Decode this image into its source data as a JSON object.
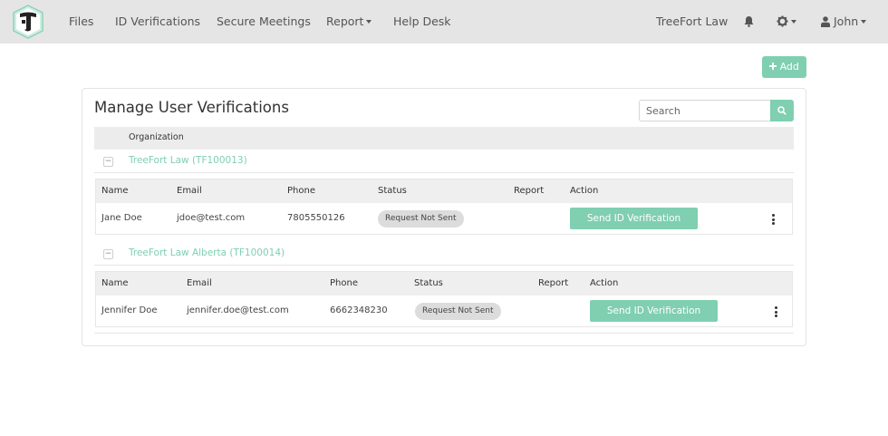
{
  "navbar": {
    "links": [
      {
        "label": "Files"
      },
      {
        "label": "ID Verifications"
      },
      {
        "label": "Secure Meetings"
      },
      {
        "label": "Report"
      },
      {
        "label": "Help Desk"
      }
    ],
    "organization": "TreeFort Law",
    "user": "John",
    "icons": {
      "notifications": "bell-icon",
      "settings": "gear-icon",
      "user": "user-icon"
    }
  },
  "actions": {
    "add_label": "Add"
  },
  "main": {
    "title": "Manage User Verifications",
    "search": {
      "placeholder": "Search",
      "value": ""
    },
    "org_column": "Organization",
    "columns": [
      "Name",
      "Email",
      "Phone",
      "Status",
      "Report",
      "Action"
    ],
    "groups": [
      {
        "label": "TreeFort Law (TF100013)",
        "rows": [
          {
            "name": "Jane Doe",
            "email": "jdoe@test.com",
            "phone": "7805550126",
            "status": "Request Not Sent",
            "report": "",
            "action": "Send ID Verification"
          }
        ]
      },
      {
        "label": "TreeFort Law Alberta (TF100014)",
        "rows": [
          {
            "name": "Jennifer Doe",
            "email": "jennifer.doe@test.com",
            "phone": "6662348230",
            "status": "Request Not Sent",
            "report": "",
            "action": "Send ID Verification"
          }
        ]
      }
    ]
  },
  "colors": {
    "accent": "#7fcfb0",
    "navbar": "#e5e5e5",
    "badge": "#dcdcdc"
  }
}
